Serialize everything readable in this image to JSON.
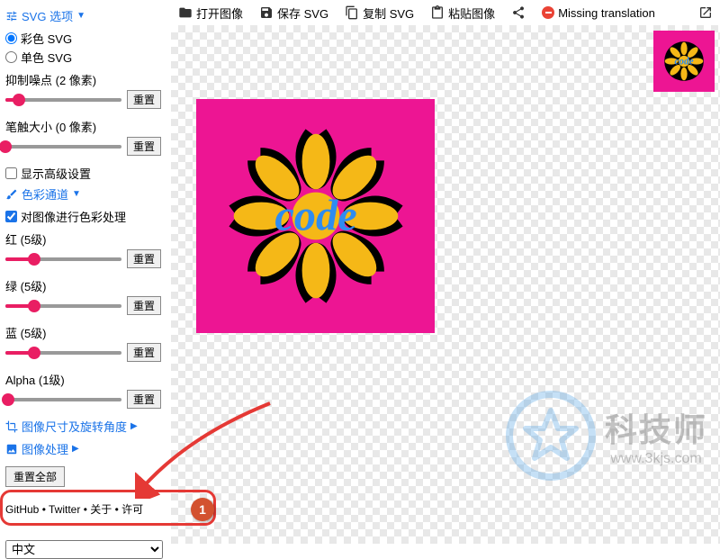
{
  "toolbar": {
    "open": "打开图像",
    "save": "保存 SVG",
    "copy": "复制 SVG",
    "paste": "粘贴图像",
    "share": "",
    "missing": "Missing translation"
  },
  "sidebar": {
    "svg_options_header": "SVG 选项",
    "color_svg": "彩色 SVG",
    "mono_svg": "单色 SVG",
    "noise": {
      "label": "抑制噪点 (2 像素)",
      "value": 12,
      "reset": "重置"
    },
    "stroke": {
      "label": "笔触大小 (0 像素)",
      "value": 0,
      "reset": "重置"
    },
    "show_advanced": "显示高级设置",
    "color_channel_header": "色彩通道",
    "posterize": "对图像进行色彩处理",
    "red": {
      "label": "红 (5级)",
      "value": 25,
      "reset": "重置"
    },
    "green": {
      "label": "绿 (5级)",
      "value": 25,
      "reset": "重置"
    },
    "blue": {
      "label": "蓝 (5级)",
      "value": 25,
      "reset": "重置"
    },
    "alpha": {
      "label": "Alpha (1级)",
      "value": 2,
      "reset": "重置"
    },
    "size_rotate_header": "图像尺寸及旋转角度",
    "image_process_header": "图像处理",
    "reset_all": "重置全部",
    "links": {
      "github": "GitHub",
      "twitter": "Twitter",
      "about": "关于",
      "license": "许可"
    },
    "language_selected": "中文"
  },
  "annotation": {
    "badge": "1"
  },
  "watermark": {
    "big": "科技师",
    "small": "www.3kjs.com"
  }
}
